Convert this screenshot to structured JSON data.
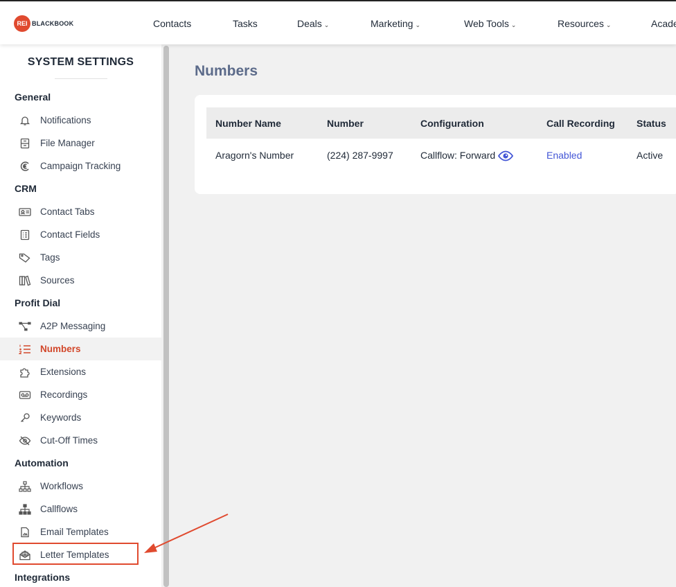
{
  "brand": {
    "badge": "REI",
    "name": "BLACKBOOK"
  },
  "nav": {
    "items": [
      {
        "label": "Contacts",
        "dropdown": false
      },
      {
        "label": "Tasks",
        "dropdown": false
      },
      {
        "label": "Deals",
        "dropdown": true
      },
      {
        "label": "Marketing",
        "dropdown": true
      },
      {
        "label": "Web Tools",
        "dropdown": true
      },
      {
        "label": "Resources",
        "dropdown": true
      },
      {
        "label": "Acade",
        "dropdown": false
      }
    ],
    "chevron": "⌄"
  },
  "sidebar": {
    "title": "SYSTEM SETTINGS",
    "sections": [
      {
        "heading": "General",
        "items": [
          {
            "label": "Notifications",
            "icon": "bell-icon"
          },
          {
            "label": "File Manager",
            "icon": "file-cabinet-icon"
          },
          {
            "label": "Campaign Tracking",
            "icon": "signal-icon"
          }
        ]
      },
      {
        "heading": "CRM",
        "items": [
          {
            "label": "Contact Tabs",
            "icon": "id-card-icon"
          },
          {
            "label": "Contact Fields",
            "icon": "list-form-icon"
          },
          {
            "label": "Tags",
            "icon": "tag-icon"
          },
          {
            "label": "Sources",
            "icon": "books-icon"
          }
        ]
      },
      {
        "heading": "Profit Dial",
        "items": [
          {
            "label": "A2P Messaging",
            "icon": "network-icon"
          },
          {
            "label": "Numbers",
            "icon": "numbered-list-icon",
            "active": true
          },
          {
            "label": "Extensions",
            "icon": "puzzle-icon"
          },
          {
            "label": "Recordings",
            "icon": "voicemail-icon"
          },
          {
            "label": "Keywords",
            "icon": "key-icon"
          },
          {
            "label": "Cut-Off Times",
            "icon": "eye-slash-icon"
          }
        ]
      },
      {
        "heading": "Automation",
        "items": [
          {
            "label": "Workflows",
            "icon": "hierarchy-icon"
          },
          {
            "label": "Callflows",
            "icon": "hierarchy-filled-icon"
          },
          {
            "label": "Email Templates",
            "icon": "document-image-icon"
          },
          {
            "label": "Letter Templates",
            "icon": "envelope-open-icon"
          }
        ]
      },
      {
        "heading": "Integrations",
        "items": []
      }
    ]
  },
  "main": {
    "title": "Numbers",
    "table": {
      "columns": [
        "Number Name",
        "Number",
        "Configuration",
        "Call Recording",
        "Status"
      ],
      "rows": [
        {
          "name": "Aragorn's Number",
          "number": "(224) 287-9997",
          "configuration": "Callflow: Forward",
          "call_recording": "Enabled",
          "status": "Active"
        }
      ]
    }
  },
  "colors": {
    "accent": "#d2472a",
    "brand": "#e04a2f",
    "link": "#4356d6",
    "title": "#5c6b8a",
    "annotation": "#e04a2f"
  }
}
